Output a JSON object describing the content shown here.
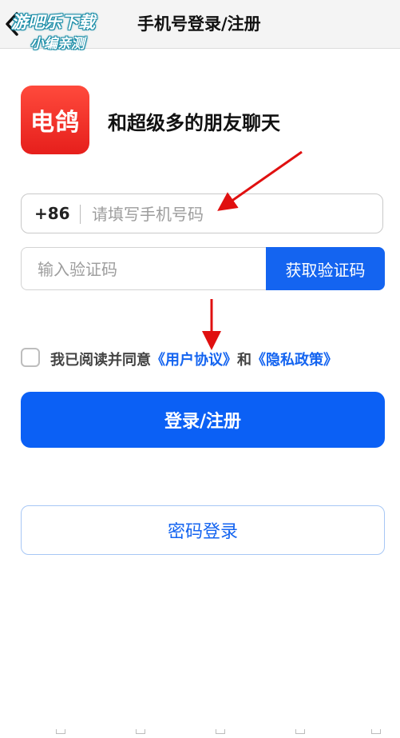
{
  "header": {
    "watermark_line1": "游吧乐下载",
    "watermark_line2": "小编亲测",
    "title": "手机号登录/注册"
  },
  "app": {
    "logo_text": "电鸽",
    "tagline": "和超级多的朋友聊天"
  },
  "phone": {
    "country_code": "+86",
    "placeholder": "请填写手机号码",
    "value": ""
  },
  "verification": {
    "placeholder": "输入验证码",
    "value": "",
    "get_code_label": "获取验证码"
  },
  "agreement": {
    "checked": false,
    "prefix": "我已阅读并同意",
    "user_agreement_link": "《用户协议》",
    "conjunction": "和",
    "privacy_policy_link": "《隐私政策》"
  },
  "actions": {
    "login_register_label": "登录/注册",
    "password_login_label": "密码登录"
  },
  "colors": {
    "accent": "#0b60f5",
    "logo": "#f2302a",
    "annotation_arrow": "#e01010"
  },
  "icons": {
    "back": "chevron-left-icon",
    "checkbox": "checkbox-unchecked-icon"
  }
}
